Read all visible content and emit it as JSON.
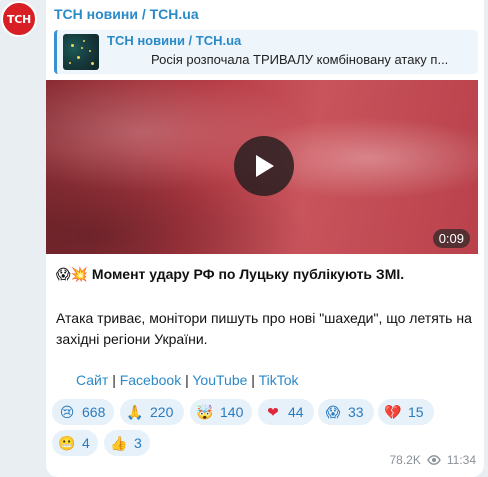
{
  "channel": {
    "avatar_text": "ТСН",
    "name": "ТСН новини / TCH.ua",
    "brand_color": "#d81f26"
  },
  "forwarded": {
    "title": "ТСН новини / TCH.ua",
    "text": "Росія розпочала ТРИВАЛУ комбіновану атаку п..."
  },
  "video": {
    "duration": "0:09"
  },
  "post": {
    "headline_emoji": "😱💥",
    "headline": "Момент удару РФ по Луцьку публікують ЗМІ.",
    "body": "Атака триває, монітори пишуть про нові \"шахеди\", що летять на західні регіони України."
  },
  "links": {
    "site": "Сайт",
    "facebook": "Facebook",
    "youtube": "YouTube",
    "tiktok": "TikTok",
    "separator": "|"
  },
  "reactions": [
    {
      "icon": "crying-face-icon",
      "emoji": "😢",
      "count": "668"
    },
    {
      "icon": "folded-hands-icon",
      "emoji": "🙏",
      "count": "220"
    },
    {
      "icon": "exploding-head-icon",
      "emoji": "🤯",
      "count": "140"
    },
    {
      "icon": "red-heart-icon",
      "emoji": "❤",
      "count": "44"
    },
    {
      "icon": "screaming-face-icon",
      "emoji": "😱",
      "count": "33"
    },
    {
      "icon": "broken-heart-icon",
      "emoji": "💔",
      "count": "15"
    },
    {
      "icon": "grimacing-face-icon",
      "emoji": "😬",
      "count": "4"
    },
    {
      "icon": "thumbs-up-icon",
      "emoji": "👍",
      "count": "3"
    }
  ],
  "meta": {
    "views": "78.2K",
    "time": "11:34"
  }
}
